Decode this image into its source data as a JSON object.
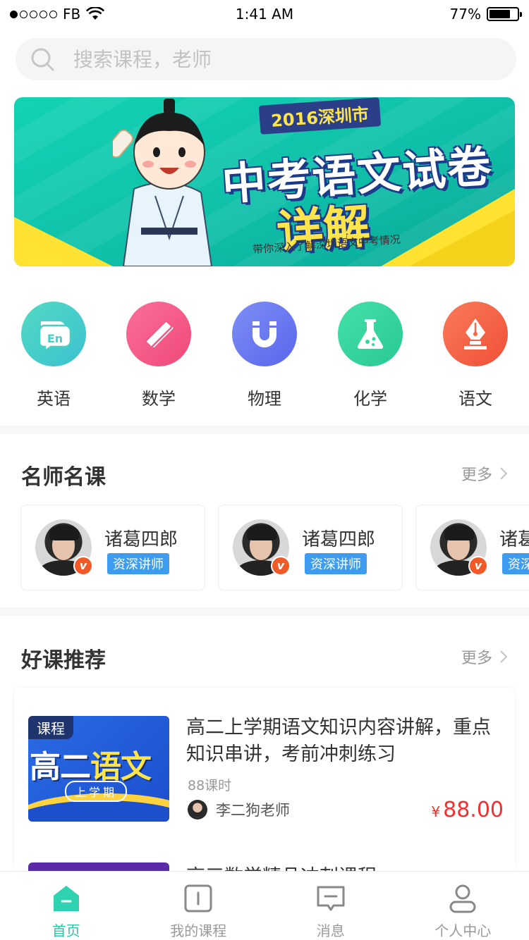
{
  "status_bar": {
    "carrier": "FB",
    "time": "1:41 AM",
    "battery": "77%"
  },
  "search": {
    "placeholder": "搜索课程，老师"
  },
  "banner": {
    "tag": "2016深圳市",
    "headline": "中考语文试卷",
    "headline2": "详解",
    "subtitle": "带你深入了解深圳语文中考情况"
  },
  "categories": [
    {
      "label": "英语",
      "icon": "english-chat-icon",
      "color": "#45d0c6"
    },
    {
      "label": "数学",
      "icon": "ruler-pencil-icon",
      "color": "#f45b8b"
    },
    {
      "label": "物理",
      "icon": "magnet-icon",
      "color": "#6a78f0"
    },
    {
      "label": "化学",
      "icon": "flask-icon",
      "color": "#33d6a0"
    },
    {
      "label": "语文",
      "icon": "pen-nib-icon",
      "color": "#f5664a"
    }
  ],
  "famous": {
    "title": "名师名课",
    "more": "更多",
    "teachers": [
      {
        "name": "诸葛四郎",
        "badge": "资深讲师"
      },
      {
        "name": "诸葛四郎",
        "badge": "资深讲师"
      },
      {
        "name": "诸葛四郎",
        "badge": "资深讲师"
      }
    ]
  },
  "recommend": {
    "title": "好课推荐",
    "more": "更多",
    "courses": [
      {
        "thumb_tag": "课程",
        "thumb_big_white": "高二",
        "thumb_big_yellow": "语文",
        "thumb_pill": "上学期",
        "title": "高二上学期语文知识内容讲解，重点知识串讲，考前冲刺练习",
        "hours": "88课时",
        "teacher": "李二狗老师",
        "price_symbol": "¥",
        "price": "88.00"
      },
      {
        "title": "高三数学精品冲刺课程"
      }
    ]
  },
  "tabs": [
    {
      "label": "首页",
      "icon": "home-icon",
      "active": true
    },
    {
      "label": "我的课程",
      "icon": "course-icon",
      "active": false
    },
    {
      "label": "消息",
      "icon": "message-icon",
      "active": false
    },
    {
      "label": "个人中心",
      "icon": "profile-icon",
      "active": false
    }
  ],
  "colors": {
    "accent": "#1fc9a7",
    "price": "#f2302f",
    "badge": "#3d9bf0"
  }
}
